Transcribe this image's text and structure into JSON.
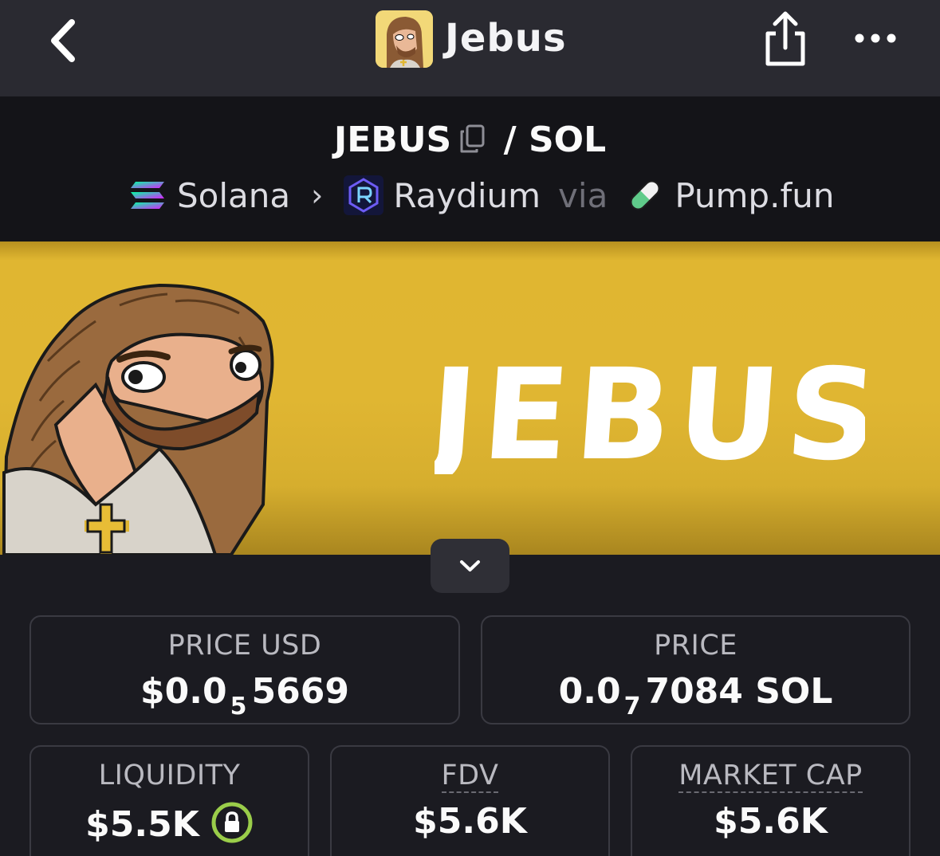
{
  "header": {
    "title": "Jebus",
    "back_icon": "chevron-left-icon",
    "share_icon": "share-icon",
    "more_icon": "more-horizontal-icon"
  },
  "pair": {
    "base": "JEBUS",
    "separator": "/",
    "quote": "SOL",
    "chain": "Solana",
    "dex": "Raydium",
    "via_label": "via",
    "launchpad": "Pump.fun"
  },
  "banner": {
    "text": "JEBUS",
    "background_color": "#e0b632"
  },
  "stats": {
    "price_usd": {
      "label": "PRICE USD",
      "prefix": "$0.0",
      "zeros": "5",
      "digits": "5669"
    },
    "price_native": {
      "label": "PRICE",
      "prefix": "0.0",
      "zeros": "7",
      "digits": "7084 SOL"
    },
    "liquidity": {
      "label": "LIQUIDITY",
      "value": "$5.5K",
      "locked": true
    },
    "fdv": {
      "label": "FDV",
      "value": "$5.6K"
    },
    "market_cap": {
      "label": "MARKET CAP",
      "value": "$5.6K"
    }
  },
  "colors": {
    "topbar": "#2a2a31",
    "background": "#1b1b21",
    "lock_ring": "#9acd4a"
  }
}
